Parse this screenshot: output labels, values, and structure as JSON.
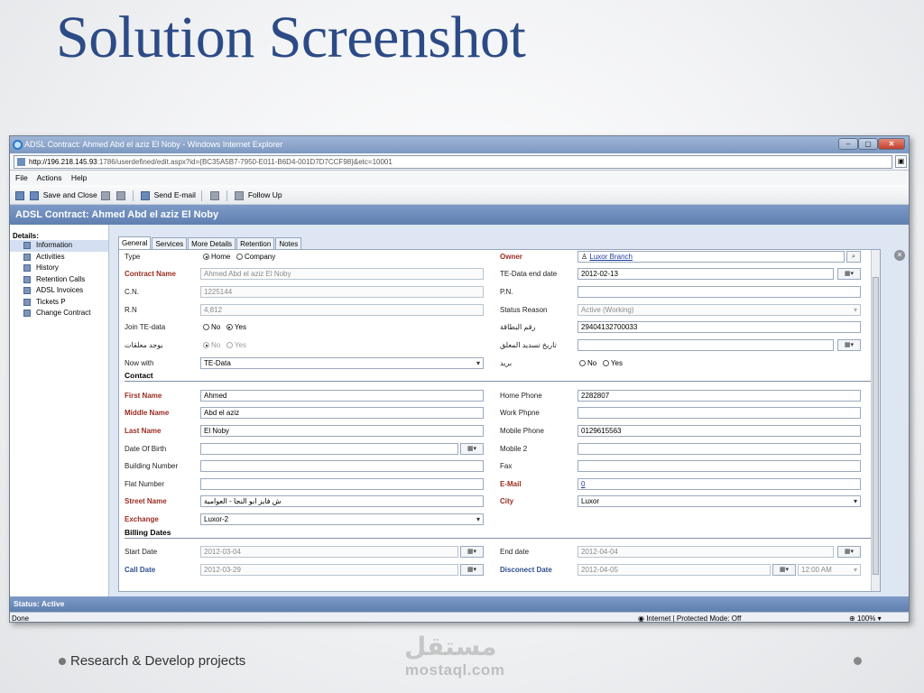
{
  "slide": {
    "title": "Solution Screenshot",
    "footer": "Research & Develop projects",
    "watermark_ar": "مستقل",
    "watermark": "mostaql.com"
  },
  "window": {
    "title": "ADSL Contract: Ahmed Abd el aziz El Noby - Windows Internet Explorer",
    "url_host": "http://196.218.145.93",
    "url_rest": ":1786/userdefined/edit.aspx?id={BC35A5B7-7950-E011-B6D4-001D7D7CCF98}&etc=10001",
    "min": "–",
    "max": "▢",
    "close": "✕"
  },
  "menu": [
    "File",
    "Actions",
    "Help"
  ],
  "toolbar": {
    "save_close": "Save and Close",
    "send_email": "Send E-mail",
    "follow_up": "Follow Up"
  },
  "form_title": "ADSL Contract: Ahmed Abd el aziz El Noby",
  "sidebar": {
    "section": "Details:",
    "items": [
      "Information",
      "Activities",
      "History",
      "Retention Calls",
      "ADSL Invoices",
      "Tickets P",
      "Change Contract"
    ]
  },
  "tabs": [
    "General",
    "Services",
    "More Details",
    "Retention",
    "Notes"
  ],
  "form": {
    "type_label": "Type",
    "type_home": "Home",
    "type_company": "Company",
    "contract_name_label": "Contract Name",
    "contract_name": "Ahmed Abd el aziz El Noby",
    "cn_label": "C.N.",
    "cn": "1225144",
    "rn_label": "R.N",
    "rn": "4,812",
    "join_label": "Join TE-data",
    "no": "No",
    "yes": "Yes",
    "arrears_label": "يوجد معلقات",
    "now_with_label": "Now with",
    "now_with": "TE-Data",
    "owner_label": "Owner",
    "owner": "Luxor Branch",
    "te_end_label": "TE-Data end date",
    "te_end": "2012-02-13",
    "pn_label": "P.N.",
    "pn": "",
    "status_reason_label": "Status Reason",
    "status_reason": "Active (Working)",
    "id_label": "رقم البطاقة",
    "id_value": "29404132700033",
    "pay_date_label": "تاريخ تسديد المعلق",
    "mail_label": "بريد",
    "contact_section": "Contact",
    "first_name_label": "First Name",
    "first_name": "Ahmed",
    "middle_name_label": "Middle Name",
    "middle_name": "Abd el aziz",
    "last_name_label": "Last Name",
    "last_name": "El Noby",
    "dob_label": "Date Of Birth",
    "building_label": "Building Number",
    "flat_label": "Flat Number",
    "street_label": "Street Name",
    "street": "ش فايز ابو النجا - العوامية",
    "exchange_label": "Exchange",
    "exchange": "Luxor-2",
    "home_phone_label": "Home Phone",
    "home_phone": "2282807",
    "work_phone_label": "Work Phpne",
    "mobile_phone_label": "Mobile Phone",
    "mobile_phone": "0129615563",
    "mobile2_label": "Mobile 2",
    "fax_label": "Fax",
    "email_label": "E-Mail",
    "email": "0",
    "city_label": "City",
    "city": "Luxor",
    "billing_section": "Billing Dates",
    "start_date_label": "Start Date",
    "start_date": "2012-03-04",
    "call_date_label": "Call Date",
    "call_date": "2012-03-29",
    "end_date_label": "End date",
    "end_date": "2012-04-04",
    "disconnect_label": "Disconect Date",
    "disconnect_date": "2012-04-05",
    "disconnect_time": "12:00 AM",
    "cal_btn": "▦▾"
  },
  "status": {
    "form": "Status: Active",
    "ie_done": "Done",
    "ie_zone": "Internet | Protected Mode: Off",
    "ie_zoom": "100%"
  }
}
